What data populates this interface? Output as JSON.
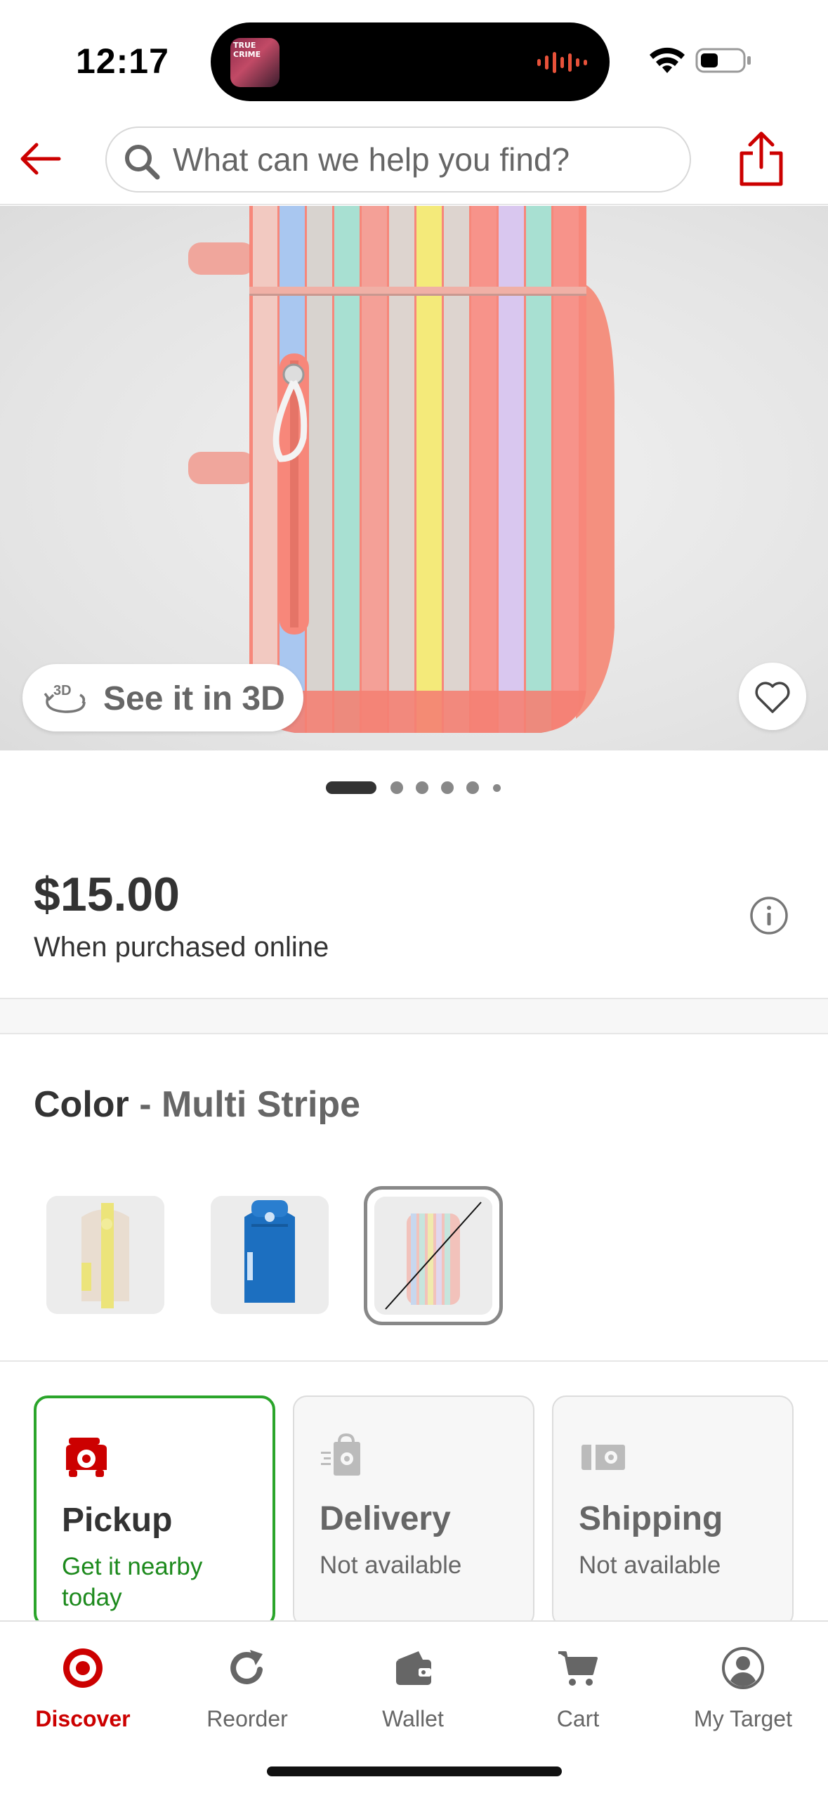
{
  "status_bar": {
    "time": "12:17",
    "island_thumb_text": "TRUE CRIME"
  },
  "header": {
    "search_placeholder": "What can we help you find?"
  },
  "product": {
    "see_in_3d_label": "See it in 3D",
    "image_count": 6,
    "current_image": 1,
    "price": "$15.00",
    "price_note": "When purchased online"
  },
  "color": {
    "label": "Color",
    "separator": " - ",
    "selected": "Multi Stripe"
  },
  "fulfillment": [
    {
      "title": "Pickup",
      "subtitle": "Get it nearby today",
      "active": true
    },
    {
      "title": "Delivery",
      "subtitle": "Not available",
      "active": false
    },
    {
      "title": "Shipping",
      "subtitle": "Not available",
      "active": false
    }
  ],
  "tabs": [
    {
      "label": "Discover",
      "icon": "target-bullseye-icon",
      "active": true
    },
    {
      "label": "Reorder",
      "icon": "reorder-icon",
      "active": false
    },
    {
      "label": "Wallet",
      "icon": "wallet-icon",
      "active": false
    },
    {
      "label": "Cart",
      "icon": "cart-icon",
      "active": false
    },
    {
      "label": "My Target",
      "icon": "account-icon",
      "active": false
    }
  ],
  "colors": {
    "brand_red": "#cc0000",
    "pickup_green": "#2ba52b"
  }
}
